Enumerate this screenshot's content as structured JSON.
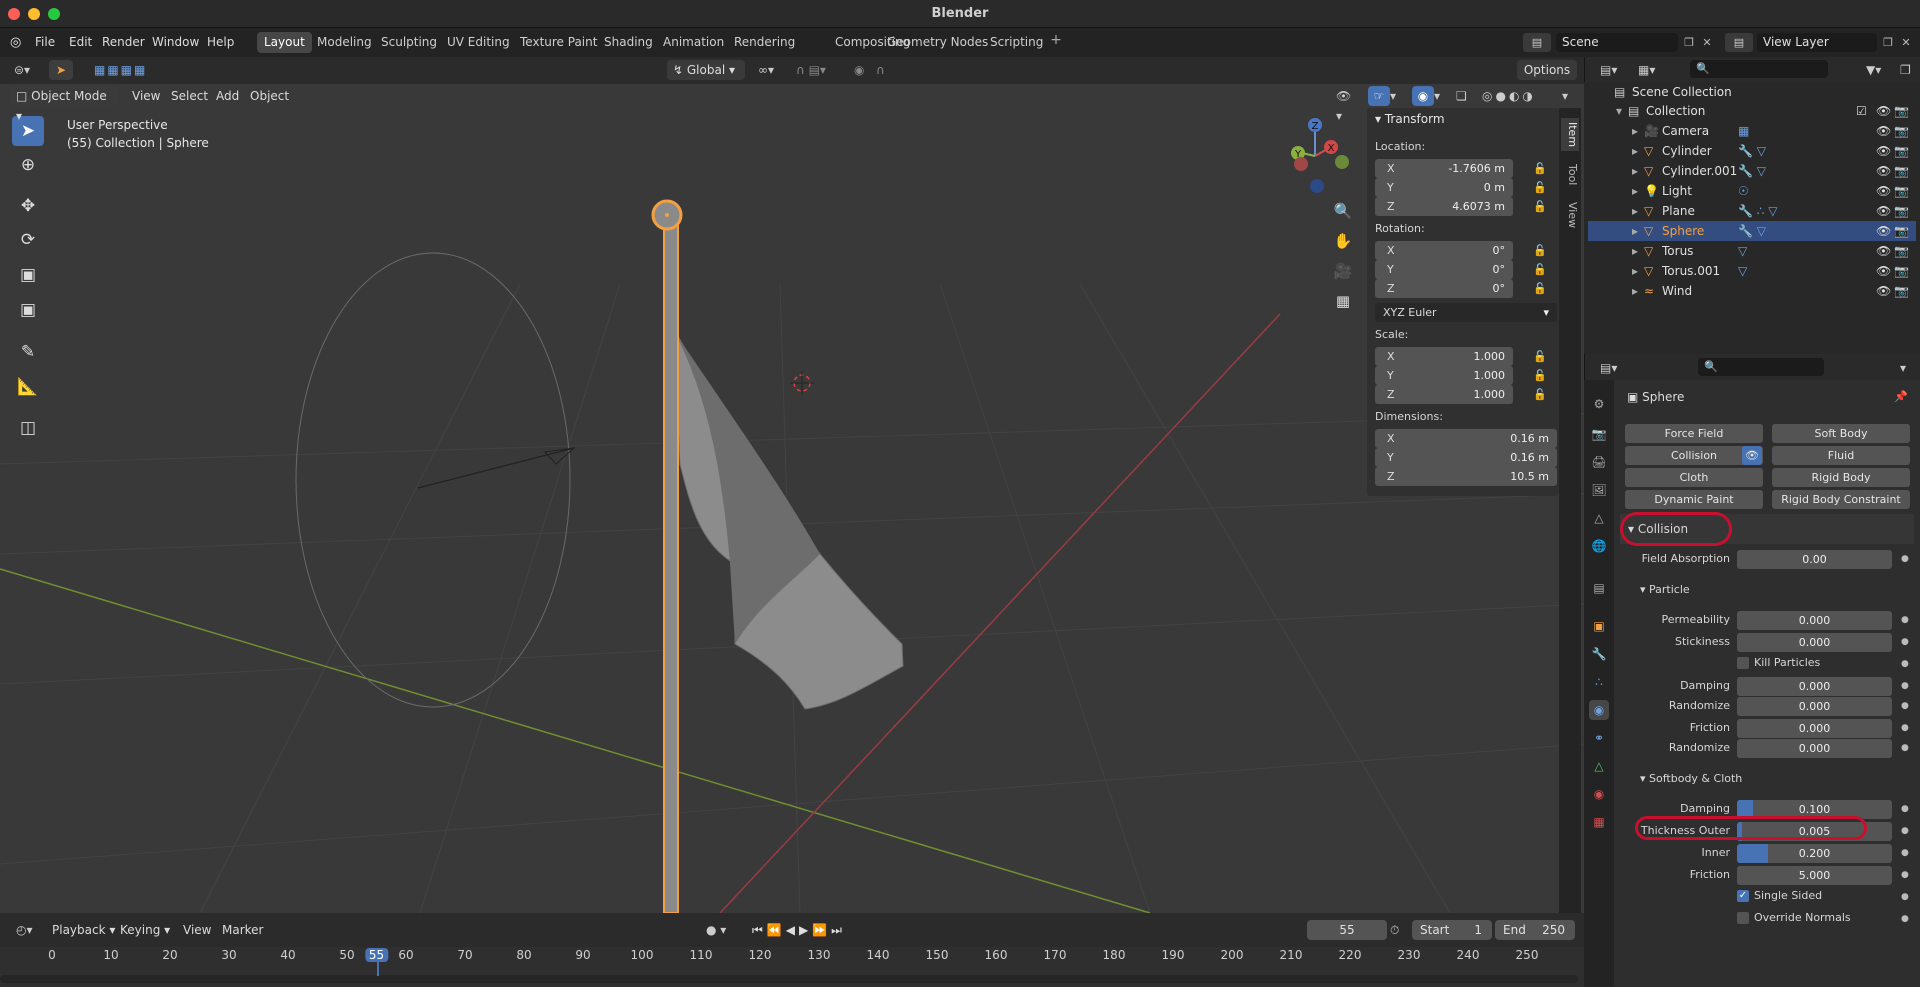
{
  "app": {
    "title": "Blender"
  },
  "menus": [
    "File",
    "Edit",
    "Render",
    "Window",
    "Help"
  ],
  "workspaces": [
    "Layout",
    "Modeling",
    "Sculpting",
    "UV Editing",
    "Texture Paint",
    "Shading",
    "Animation",
    "Rendering",
    "Compositing",
    "Geometry Nodes",
    "Scripting"
  ],
  "scene": {
    "name": "Scene",
    "view_layer": "View Layer"
  },
  "header": {
    "transform_orientation": "Global",
    "options": "Options"
  },
  "viewport_header": {
    "mode": "Object Mode",
    "menus": [
      "View",
      "Select",
      "Add",
      "Object"
    ]
  },
  "viewport": {
    "perspective": "User Perspective",
    "context": "(55) Collection | Sphere"
  },
  "gizmo": {
    "x": "X",
    "y": "Y",
    "z": "Z"
  },
  "npanel": {
    "title": "Transform",
    "location_label": "Location:",
    "location": [
      {
        "axis": "X",
        "value": "-1.7606 m"
      },
      {
        "axis": "Y",
        "value": "0 m"
      },
      {
        "axis": "Z",
        "value": "4.6073 m"
      }
    ],
    "rotation_label": "Rotation:",
    "rotation": [
      {
        "axis": "X",
        "value": "0°"
      },
      {
        "axis": "Y",
        "value": "0°"
      },
      {
        "axis": "Z",
        "value": "0°"
      }
    ],
    "rotation_mode": "XYZ Euler",
    "scale_label": "Scale:",
    "scale": [
      {
        "axis": "X",
        "value": "1.000"
      },
      {
        "axis": "Y",
        "value": "1.000"
      },
      {
        "axis": "Z",
        "value": "1.000"
      }
    ],
    "dimensions_label": "Dimensions:",
    "dimensions": [
      {
        "axis": "X",
        "value": "0.16 m"
      },
      {
        "axis": "Y",
        "value": "0.16 m"
      },
      {
        "axis": "Z",
        "value": "10.5 m"
      }
    ],
    "tabs": [
      "Item",
      "Tool",
      "View"
    ]
  },
  "outliner": {
    "root": "Scene Collection",
    "collection": "Collection",
    "items": [
      "Camera",
      "Cylinder",
      "Cylinder.001",
      "Light",
      "Plane",
      "Sphere",
      "Torus",
      "Torus.001",
      "Wind"
    ]
  },
  "properties": {
    "object_name": "Sphere",
    "physics_buttons": [
      "Force Field",
      "Soft Body",
      "Collision",
      "Fluid",
      "Cloth",
      "Rigid Body",
      "Dynamic Paint",
      "Rigid Body Constraint"
    ],
    "collision_header": "Collision",
    "field_absorption": {
      "label": "Field Absorption",
      "value": "0.00"
    },
    "particle_header": "Particle",
    "permeability": {
      "label": "Permeability",
      "value": "0.000"
    },
    "stickiness": {
      "label": "Stickiness",
      "value": "0.000"
    },
    "kill_particles": "Kill Particles",
    "damping": {
      "label": "Damping",
      "value": "0.000"
    },
    "randomize": {
      "label": "Randomize",
      "value": "0.000"
    },
    "friction": {
      "label": "Friction",
      "value": "0.000"
    },
    "randomize2": {
      "label": "Randomize",
      "value": "0.000"
    },
    "softbody_header": "Softbody & Cloth",
    "sb_damping": {
      "label": "Damping",
      "value": "0.100",
      "fraction": 0.1
    },
    "thickness_outer": {
      "label": "Thickness Outer",
      "value": "0.005",
      "fraction": 0.005
    },
    "inner": {
      "label": "Inner",
      "value": "0.200",
      "fraction": 0.2
    },
    "sb_friction": {
      "label": "Friction",
      "value": "5.000"
    },
    "single_sided": "Single Sided",
    "override_normals": "Override Normals"
  },
  "timeline": {
    "menus": [
      "Playback",
      "Keying",
      "View",
      "Marker"
    ],
    "current_frame": "55",
    "start_label": "Start",
    "start": "1",
    "end_label": "End",
    "end": "250",
    "ticks": [
      "0",
      "10",
      "20",
      "30",
      "40",
      "50",
      "55",
      "60",
      "70",
      "80",
      "90",
      "100",
      "110",
      "120",
      "130",
      "140",
      "150",
      "160",
      "170",
      "180",
      "190",
      "200",
      "210",
      "220",
      "230",
      "240",
      "250"
    ]
  }
}
